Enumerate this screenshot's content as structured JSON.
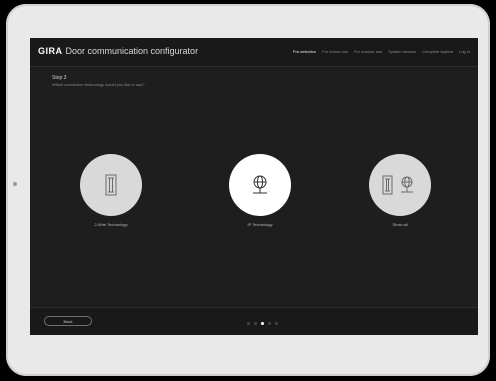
{
  "header": {
    "logo": "GIRA",
    "title": "Door communication configurator",
    "nav": [
      {
        "label": "Pre-selection",
        "active": true
      },
      {
        "label": "For indoor use",
        "active": false
      },
      {
        "label": "For outdoor use",
        "active": false
      },
      {
        "label": "System devices",
        "active": false
      },
      {
        "label": "Complete system",
        "active": false
      },
      {
        "label": "Log in",
        "active": false
      }
    ]
  },
  "step": {
    "title": "Step 3",
    "question": "Which connection technology would you like to use?"
  },
  "options": [
    {
      "label": "2-Wire Technology",
      "icon": "two-wire-icon",
      "selected": false
    },
    {
      "label": "IP Technology",
      "icon": "ip-globe-icon",
      "selected": true
    },
    {
      "label": "Show all",
      "icon": "show-all-icon",
      "selected": false
    }
  ],
  "footer": {
    "back_label": "Back",
    "pagination": {
      "total": 5,
      "current": 3
    }
  },
  "colors": {
    "screen_bg": "#1e1e1e",
    "bar_bg": "#191919",
    "option_circle": "#d9d9d9",
    "option_circle_selected": "#ffffff"
  }
}
